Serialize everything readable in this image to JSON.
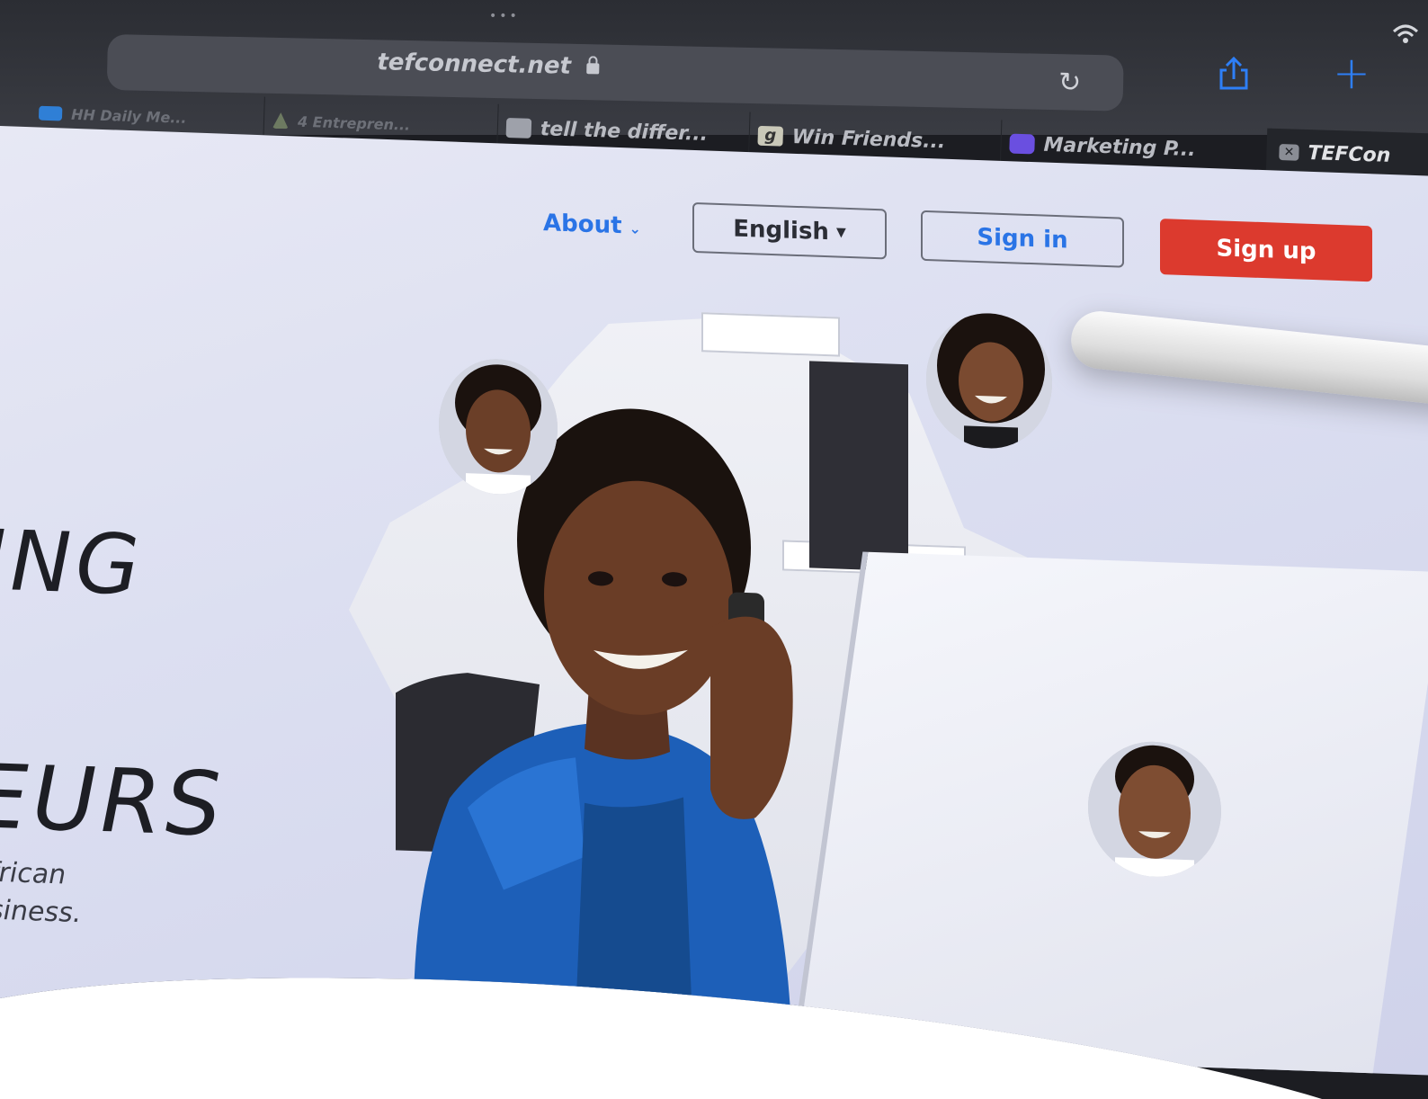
{
  "browser": {
    "url": "tefconnect.net",
    "tabs": [
      {
        "label": "HH Daily Me...",
        "icon": "bird-icon",
        "icon_color": "#2f7fd6"
      },
      {
        "label": "4 Entrepren...",
        "icon": "leaf-icon",
        "icon_color": "#6d7a61"
      },
      {
        "label": "tell the differ...",
        "icon": "grid-icon",
        "icon_color": "#9ea1aa"
      },
      {
        "label": "Win Friends...",
        "icon": "g-letter-icon",
        "icon_color": "#c9c8b8"
      },
      {
        "label": "Marketing P...",
        "icon": "circle-logo-icon",
        "icon_color": "#6a4fe0"
      },
      {
        "label": "TEFCon",
        "icon": "close-tab-icon",
        "icon_color": "#8a8d95"
      }
    ],
    "accent_color": "#2e7ff7"
  },
  "nav": {
    "about": "About",
    "language": "English",
    "sign_in": "Sign in",
    "sign_up": "Sign up",
    "sign_up_color": "#dc3a2e",
    "link_color": "#2a74e6"
  },
  "hero": {
    "line1": "ING",
    "line2": "EURS",
    "sub1": "frican",
    "sub2": "siness."
  }
}
